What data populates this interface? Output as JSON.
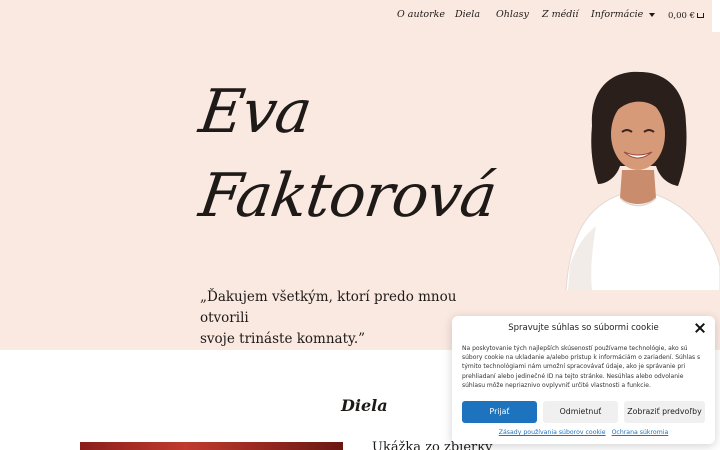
{
  "nav": {
    "items": [
      {
        "label": "O autorke"
      },
      {
        "label": "Diela"
      },
      {
        "label": "Ohlasy"
      },
      {
        "label": "Z médií"
      },
      {
        "label": "Informácie",
        "has_dropdown": true
      }
    ],
    "cart_total": "0,00 €",
    "cart_icon": "shopping-cart-icon"
  },
  "hero": {
    "first_name": "Eva",
    "last_name": "Faktorová",
    "quote_lines": [
      "„Ďakujem všetkým, ktorí predo mnou",
      "otvorili",
      "svoje trináste komnaty.”"
    ],
    "background_color": "#fae9e1"
  },
  "section": {
    "title": "Diela",
    "sample_title": "Ukážka zo zbierky"
  },
  "cookie_dialog": {
    "title": "Spravujte súhlas so súbormi cookie",
    "text": "Na poskytovanie tých najlepších skúseností používame technológie, ako sú súbory cookie na ukladanie a/alebo prístup k informáciám o zariadení. Súhlas s týmito technológiami nám umožní spracovávať údaje, ako je správanie pri prehliadaní alebo jedinečné ID na tejto stránke. Nesúhlas alebo odvolanie súhlasu môže nepriaznivo ovplyvniť určité vlastnosti a funkcie.",
    "accept_label": "Prijať",
    "deny_label": "Odmietnuť",
    "prefs_label": "Zobraziť predvoľby",
    "cookie_policy_link": "Zásady používania súborov cookie",
    "privacy_link": "Ochrana súkromia",
    "accent_color": "#1e73be"
  }
}
